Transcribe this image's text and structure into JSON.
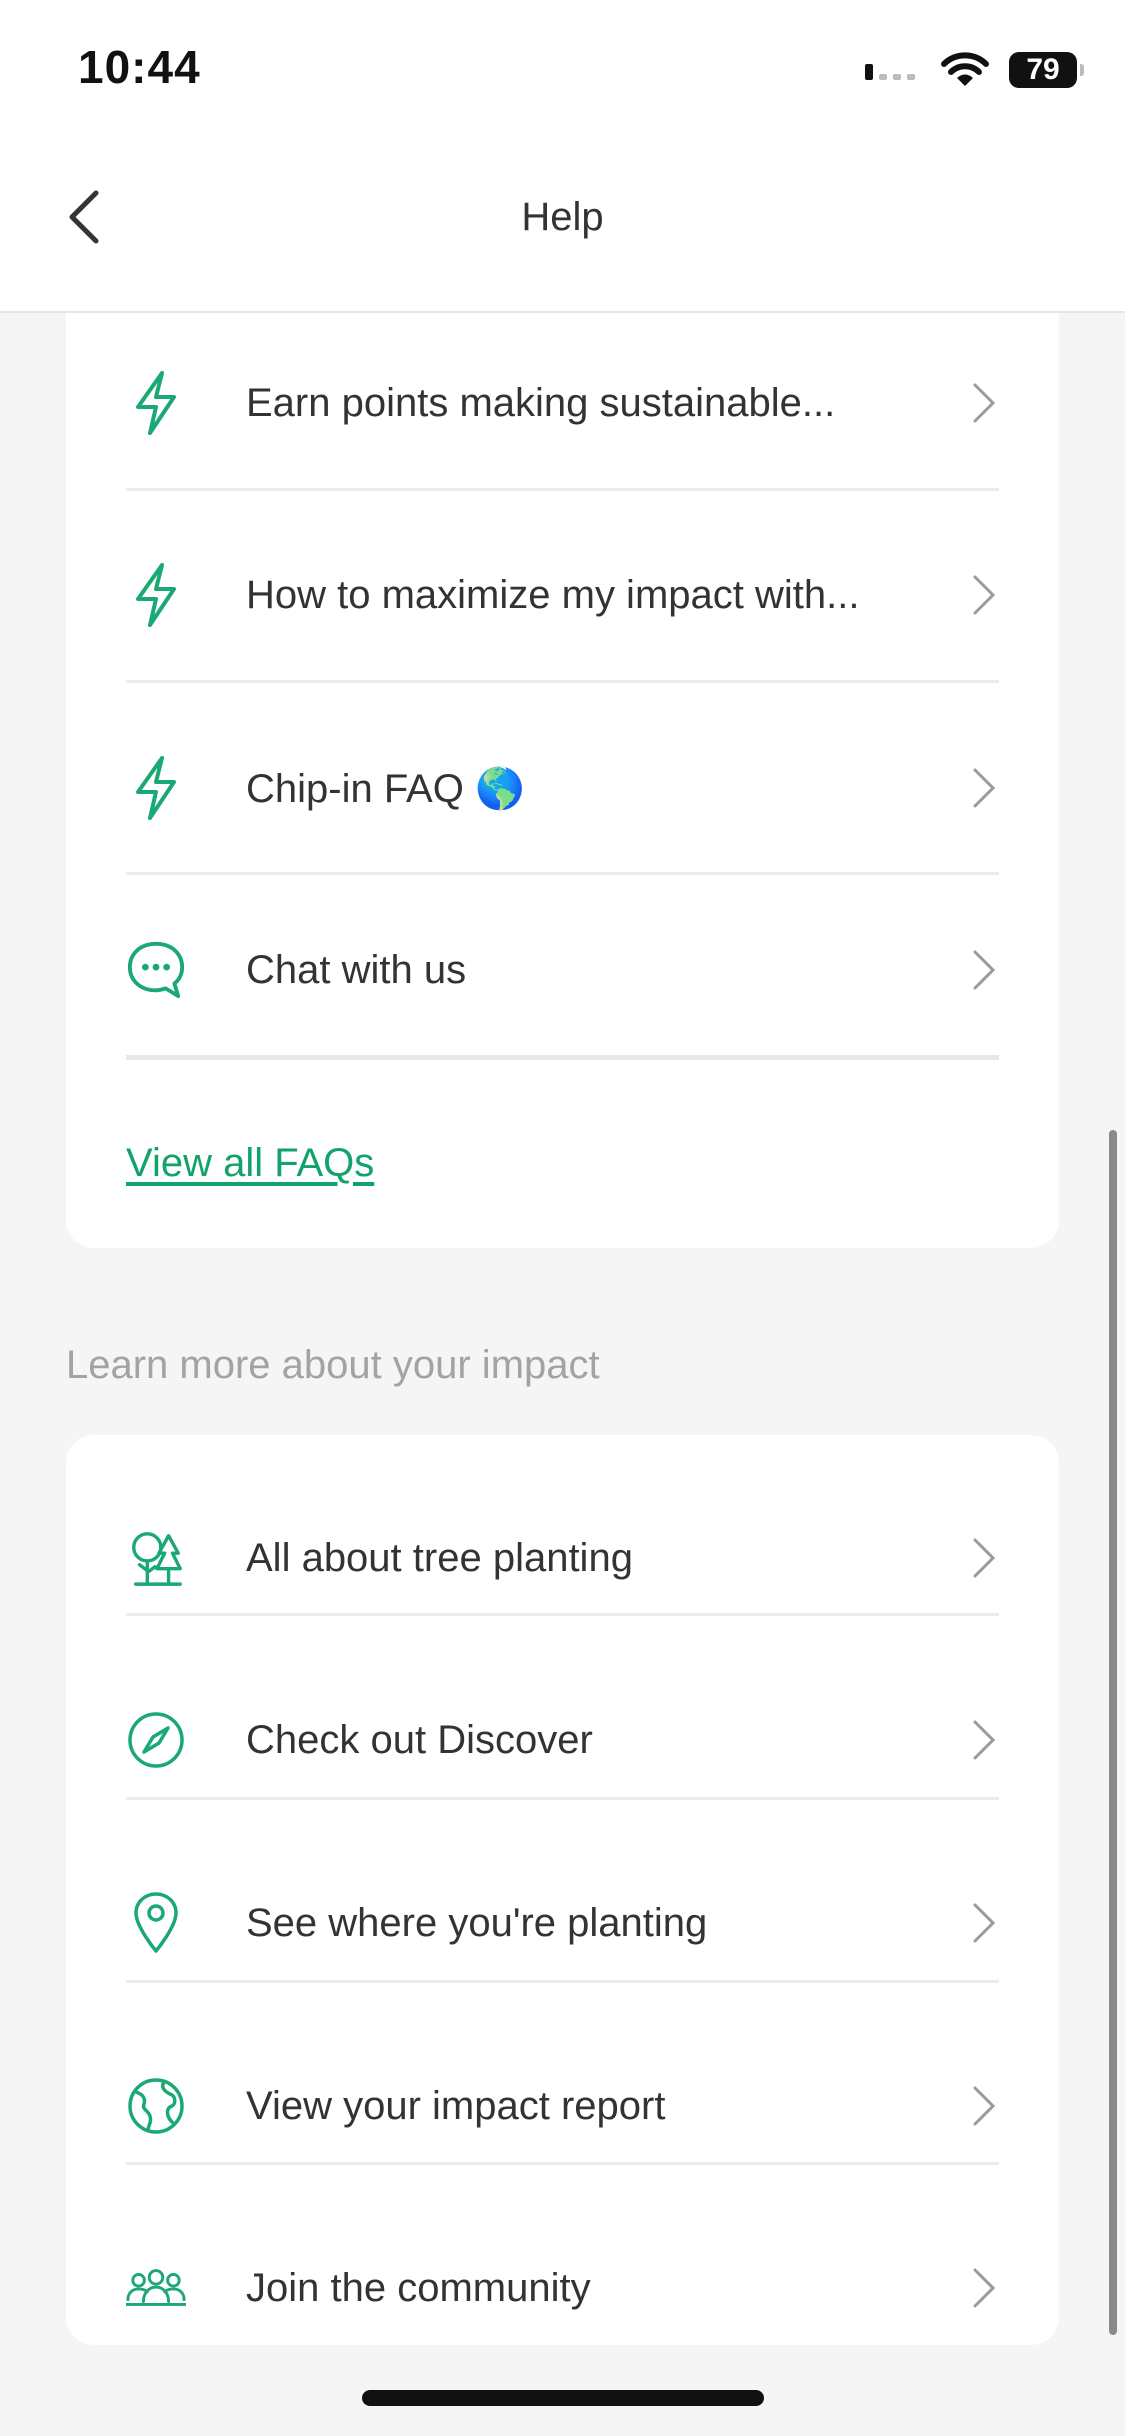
{
  "status_bar": {
    "time": "10:44",
    "battery": "79"
  },
  "header": {
    "title": "Help"
  },
  "faq_items": [
    {
      "icon": "bolt-icon",
      "label": "Earn points making sustainable..."
    },
    {
      "icon": "bolt-icon",
      "label": "How to maximize my impact with..."
    },
    {
      "icon": "bolt-icon",
      "label": "Chip-in FAQ 🌎"
    },
    {
      "icon": "chat-bubble-icon",
      "label": "Chat with us"
    }
  ],
  "view_all_faqs": "View all FAQs",
  "learn_section": {
    "heading": "Learn more about your impact",
    "items": [
      {
        "icon": "trees-icon",
        "label": "All about tree planting"
      },
      {
        "icon": "compass-icon",
        "label": "Check out Discover"
      },
      {
        "icon": "map-pin-icon",
        "label": "See where you're planting"
      },
      {
        "icon": "globe-icon",
        "label": "View your impact report"
      },
      {
        "icon": "community-icon",
        "label": "Join the community"
      }
    ]
  },
  "colors": {
    "accent": "#12a26b",
    "icon_green": "#1aa874",
    "background": "#f5f5f5"
  }
}
